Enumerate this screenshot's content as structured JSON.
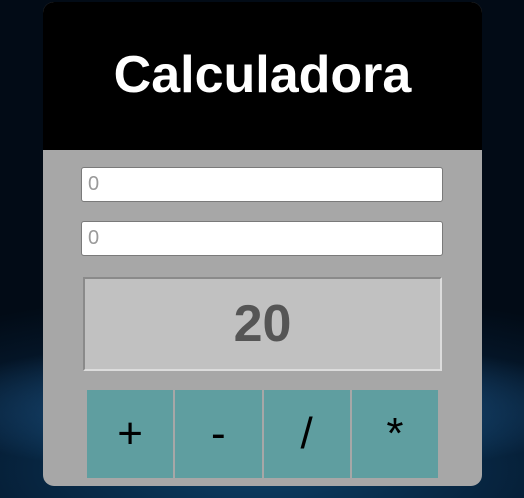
{
  "calculator": {
    "title": "Calculadora",
    "input_a": {
      "value": "",
      "placeholder": "0"
    },
    "input_b": {
      "value": "",
      "placeholder": "0"
    },
    "result": "20",
    "operations": [
      "+",
      "-",
      "/",
      "*"
    ]
  },
  "colors": {
    "header_bg": "#000000",
    "title_text": "#ffffff",
    "panel_bg": "#a7a7a7",
    "result_bg": "#c1c1c1",
    "result_text": "#555555",
    "button_bg": "#5f9ea0",
    "button_text": "#000000"
  }
}
